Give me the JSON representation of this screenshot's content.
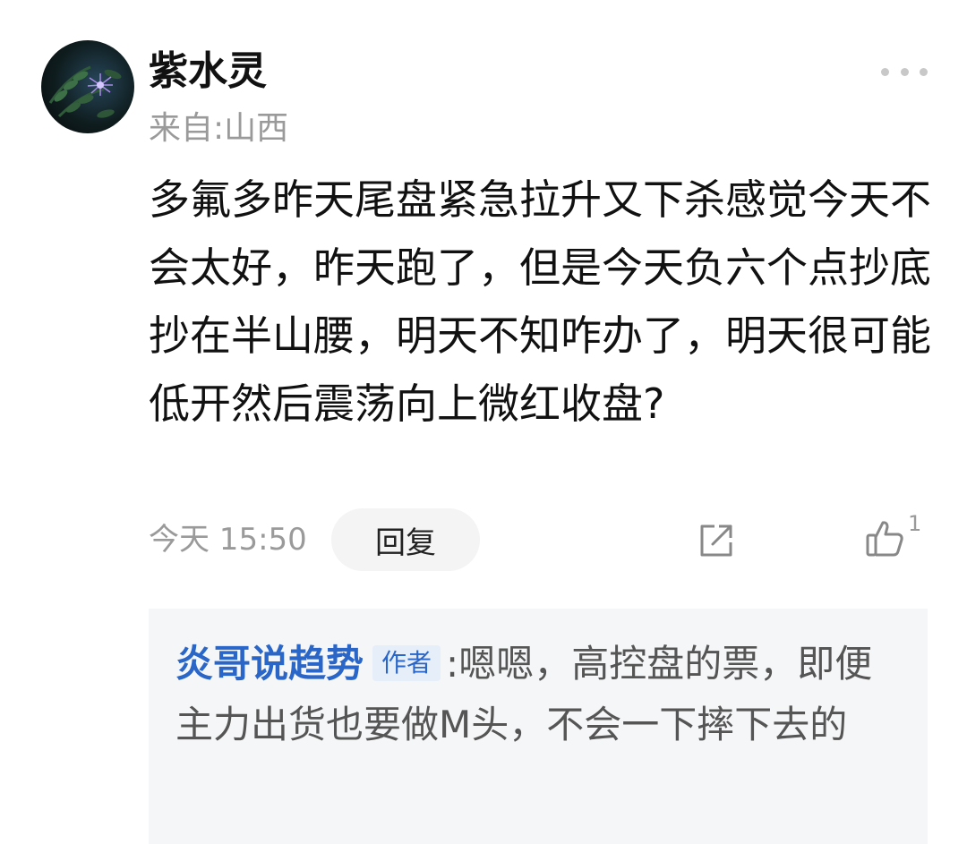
{
  "comment": {
    "username": "紫水灵",
    "location": "来自:山西",
    "body": "多氟多昨天尾盘紧急拉升又下杀感觉今天不会太好，昨天跑了，但是今天负六个点抄底抄在半山腰，明天不知咋办了，明天很可能低开然后震荡向上微红收盘?",
    "timestamp": "今天 15:50",
    "reply_label": "回复",
    "like_count": "1",
    "icons": {
      "more": "more-dots-icon",
      "share": "share-icon",
      "like": "thumbs-up-icon"
    }
  },
  "reply": {
    "author": "炎哥说趋势",
    "badge": "作者",
    "separator": ":",
    "text": "嗯嗯，高控盘的票，即便主力出货也要做M头，不会一下摔下去的"
  },
  "colors": {
    "author_link": "#2a66c8",
    "muted_text": "#9a9a9a",
    "reply_background": "#f5f6f8"
  }
}
